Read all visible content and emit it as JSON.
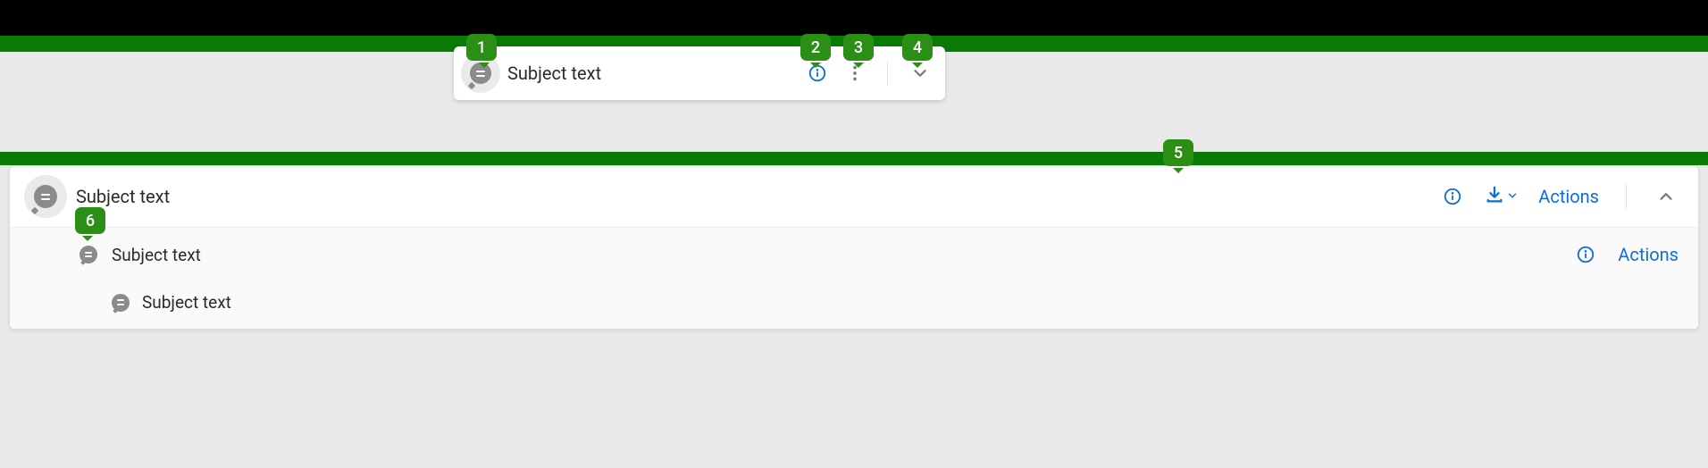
{
  "markers": {
    "m1": "1",
    "m2": "2",
    "m3": "3",
    "m4": "4",
    "m5": "5",
    "m6": "6"
  },
  "compact": {
    "subject": "Subject text"
  },
  "expanded": {
    "subject": "Subject text",
    "actions_label": "Actions",
    "child": {
      "subject": "Subject text",
      "actions_label": "Actions",
      "nested_subject": "Subject text"
    }
  },
  "icons": {
    "info": "info-icon",
    "kebab": "kebab-icon",
    "chevron_down": "chevron-down-icon",
    "chevron_up": "chevron-up-icon",
    "download": "download-icon",
    "bubble": "message-equals-icon"
  },
  "colors": {
    "accent_green": "#0a7a06",
    "accent_blue": "#0e6fd6"
  }
}
